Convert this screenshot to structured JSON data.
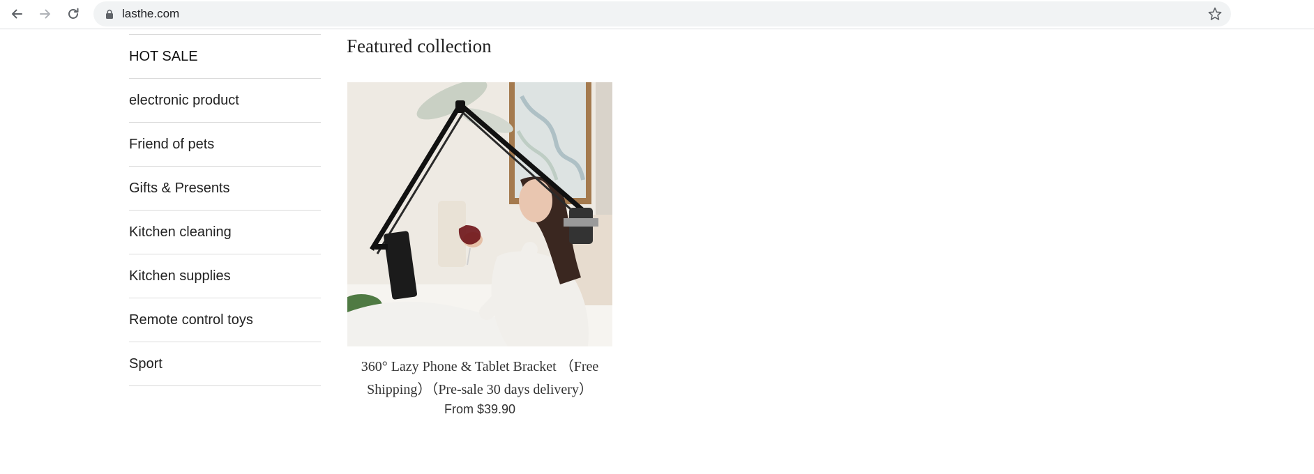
{
  "browser": {
    "url": "lasthe.com",
    "icons": {
      "back": "arrow-left-icon",
      "forward": "arrow-right-icon",
      "reload": "reload-icon",
      "secure": "lock-icon",
      "bookmark": "star-icon"
    }
  },
  "sidebar": {
    "items": [
      {
        "label": "HOT SALE"
      },
      {
        "label": "electronic product"
      },
      {
        "label": "Friend of pets"
      },
      {
        "label": "Gifts & Presents"
      },
      {
        "label": "Kitchen cleaning"
      },
      {
        "label": "Kitchen supplies"
      },
      {
        "label": "Remote control toys"
      },
      {
        "label": "Sport"
      }
    ]
  },
  "featured": {
    "title": "Featured collection",
    "products": [
      {
        "title": "360° Lazy Phone & Tablet Bracket （Free Shipping）（Pre-sale 30 days delivery）",
        "price": "From $39.90"
      }
    ]
  },
  "colors": {
    "text": "#222222",
    "divider": "#dadada",
    "omnibox": "#f1f3f4"
  }
}
